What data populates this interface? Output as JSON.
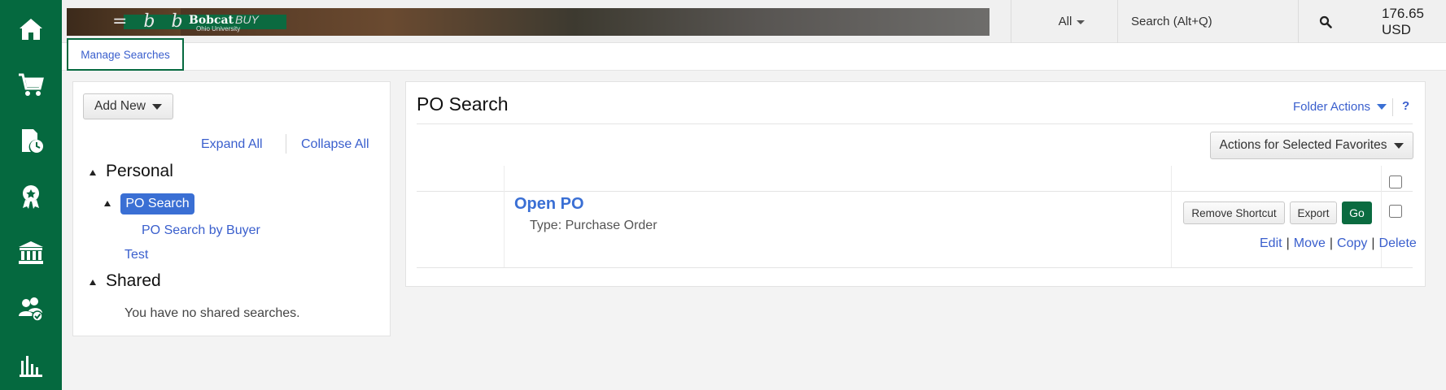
{
  "nav": {
    "items": [
      {
        "name": "home-icon"
      },
      {
        "name": "shopping-cart-icon"
      },
      {
        "name": "document-clock-icon"
      },
      {
        "name": "award-badge-icon"
      },
      {
        "name": "bank-building-icon"
      },
      {
        "name": "user-group-check-icon"
      },
      {
        "name": "bar-chart-icon"
      }
    ],
    "color": "#05693f"
  },
  "header": {
    "logo_text": "Bobcat",
    "logo_suffix": "BUY",
    "logo_sub": "Ohio University",
    "search_scope": "All",
    "search_placeholder": "Search (Alt+Q)",
    "cart_total": "176.65 USD"
  },
  "tabs": {
    "manage_searches": "Manage Searches"
  },
  "left_panel": {
    "add_new": "Add New",
    "expand_all": "Expand All",
    "collapse_all": "Collapse All",
    "personal": {
      "heading": "Personal",
      "selected": "PO Search",
      "child": "PO Search by Buyer",
      "sibling": "Test"
    },
    "shared": {
      "heading": "Shared",
      "empty": "You have no shared searches."
    }
  },
  "main": {
    "title": "PO Search",
    "folder_actions": "Folder Actions",
    "help": "?",
    "actions_selected": "Actions for Selected Favorites",
    "row": {
      "title": "Open PO",
      "type": "Type: Purchase Order",
      "remove_shortcut": "Remove Shortcut",
      "export": "Export",
      "go": "Go",
      "edit": "Edit",
      "move": "Move",
      "copy": "Copy",
      "delete": "Delete"
    }
  },
  "colors": {
    "brand_green": "#05693f",
    "link_blue": "#3a5fcd",
    "selected_blue": "#3a6fd4"
  }
}
